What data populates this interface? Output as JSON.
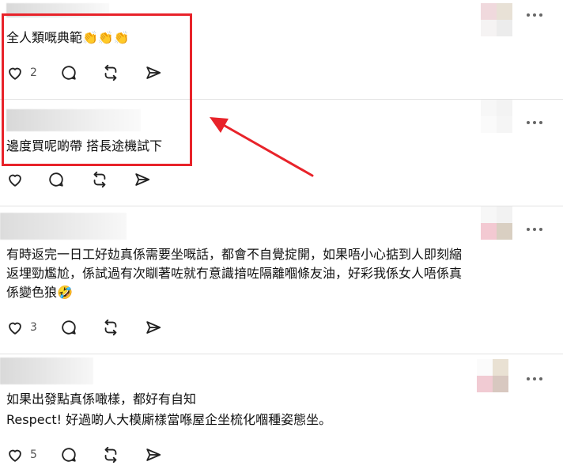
{
  "posts": [
    {
      "text_lines": [
        "全人類嘅典範👏👏👏"
      ],
      "likes": "2"
    },
    {
      "text_lines": [
        "邊度買呢啲帶 搭長途機試下"
      ],
      "likes": ""
    },
    {
      "text_lines": [
        "有時返完一日工好攰真係需要坐嘅話，都會不自覺掟開，如果唔小心掂到人即刻縮",
        "返埋勁尷尬，係試過有次瞓著咗就冇意識揞咗隔離嗰條友油，好彩我係女人唔係真",
        "係變色狼🤣"
      ],
      "likes": "3"
    },
    {
      "text_lines": [
        "如果出發點真係噉樣，都好有自知",
        "Respect! 好過啲人大模廝樣當喺屋企坐梳化嗰種姿態坐。"
      ],
      "likes": "5"
    }
  ],
  "icons": {
    "like": "heart-icon",
    "reply": "comment-bubble-icon",
    "repost": "repost-icon",
    "share": "send-icon",
    "more": "more-dots-icon"
  },
  "colors": {
    "highlight": "#e8232a",
    "divider": "#e2e2e2",
    "icon": "#222222"
  }
}
